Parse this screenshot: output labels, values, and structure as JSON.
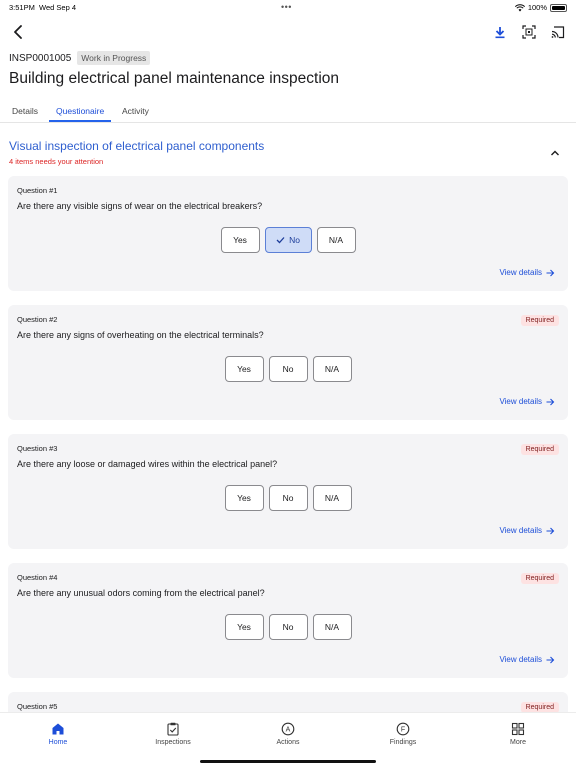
{
  "status_bar": {
    "time": "3:51PM",
    "date": "Wed Sep 4",
    "battery": "100%"
  },
  "header": {
    "inspection_id": "INSP0001005",
    "status_chip": "Work in Progress",
    "title": "Building electrical panel maintenance inspection"
  },
  "tabs": [
    {
      "label": "Details"
    },
    {
      "label": "Questionaire",
      "active": true
    },
    {
      "label": "Activity"
    }
  ],
  "section": {
    "title": "Visual inspection of electrical panel components",
    "subtitle": "4 items needs your attention"
  },
  "questions": [
    {
      "number": "Question #1",
      "text": "Are there any visible signs of wear on the electrical breakers?",
      "required": "",
      "answer": "No"
    },
    {
      "number": "Question #2",
      "text": "Are there any signs of overheating on the electrical terminals?",
      "required": "Required",
      "answer": ""
    },
    {
      "number": "Question #3",
      "text": "Are there any loose or damaged wires within the electrical panel?",
      "required": "Required",
      "answer": ""
    },
    {
      "number": "Question #4",
      "text": "Are there any unusual odors coming from the electrical panel?",
      "required": "Required",
      "answer": ""
    },
    {
      "number": "Question #5",
      "text": "",
      "required": "Required",
      "answer": ""
    }
  ],
  "answer_options": {
    "yes": "Yes",
    "no": "No",
    "na": "N/A"
  },
  "view_details_label": "View details",
  "bottom_nav": [
    {
      "label": "Home",
      "icon": "home-icon",
      "active": true
    },
    {
      "label": "Inspections",
      "icon": "clipboard-check-icon"
    },
    {
      "label": "Actions",
      "icon": "actions-icon"
    },
    {
      "label": "Findings",
      "icon": "findings-icon"
    },
    {
      "label": "More",
      "icon": "grid-icon"
    }
  ],
  "colors": {
    "accent": "#2563eb",
    "required_bg": "#fde2e2",
    "attention": "#dc2626",
    "selected_bg": "#cfdcf7"
  }
}
